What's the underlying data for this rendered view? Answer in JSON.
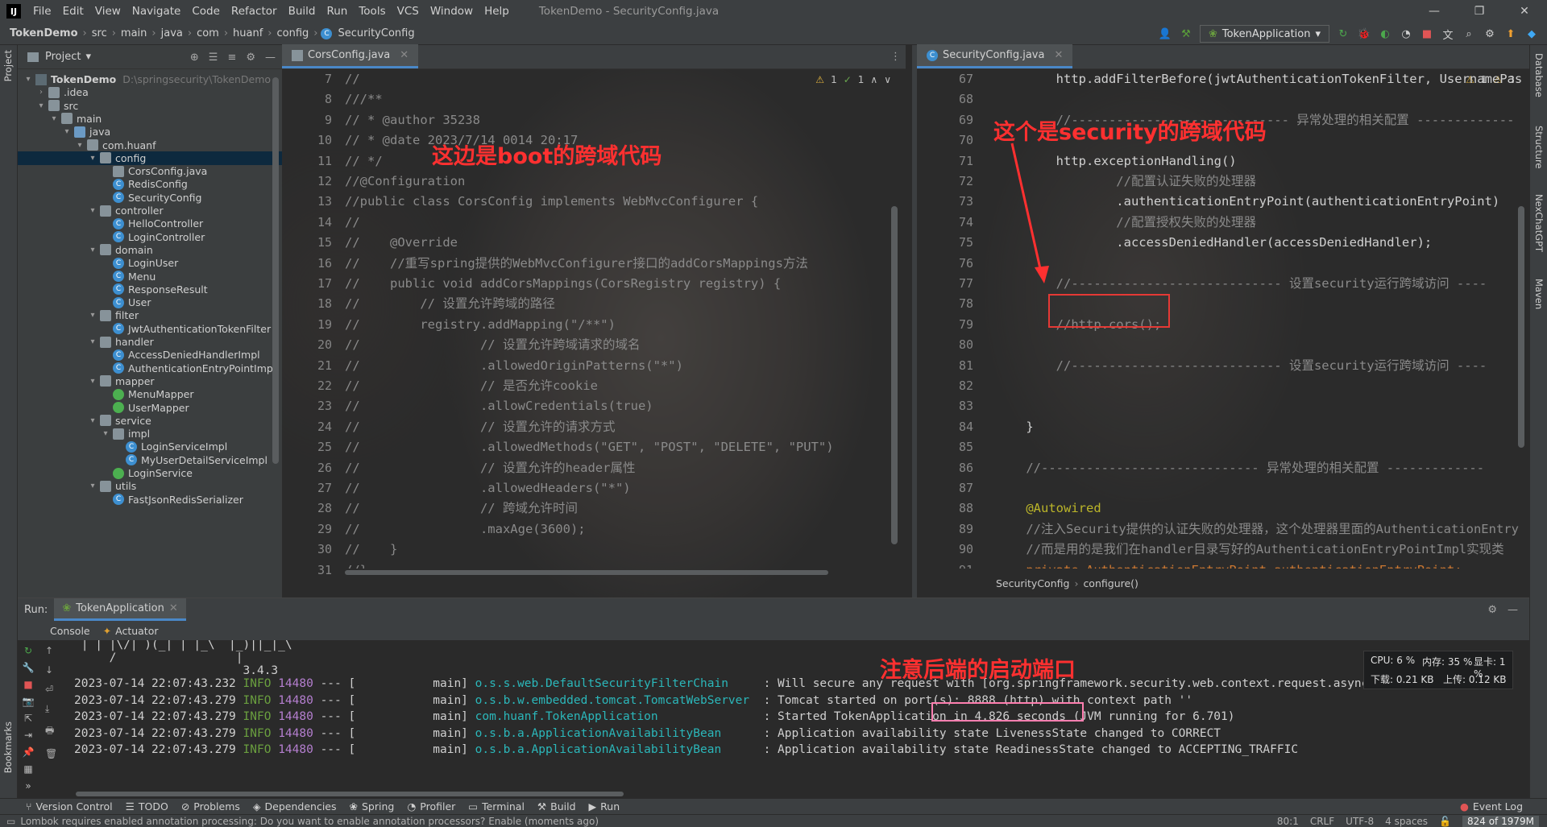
{
  "window": {
    "title": "TokenDemo - SecurityConfig.java",
    "menu": [
      "File",
      "Edit",
      "View",
      "Navigate",
      "Code",
      "Refactor",
      "Build",
      "Run",
      "Tools",
      "VCS",
      "Window",
      "Help"
    ]
  },
  "breadcrumbs": [
    "TokenDemo",
    "src",
    "main",
    "java",
    "com",
    "huanf",
    "config",
    "SecurityConfig"
  ],
  "run_config": "TokenApplication",
  "left_tabs": {
    "project": "Project",
    "bookmarks": "Bookmarks"
  },
  "right_tabs": [
    "Database",
    "Structure",
    "NexChatGPT",
    "Maven"
  ],
  "project_panel": {
    "title": "Project",
    "tree": [
      {
        "label": "TokenDemo",
        "hint": "D:\\springsecurity\\TokenDemo",
        "depth": 0,
        "icon": "proj",
        "arrow": "▾"
      },
      {
        "label": ".idea",
        "depth": 1,
        "icon": "folder",
        "arrow": "›"
      },
      {
        "label": "src",
        "depth": 1,
        "icon": "folder",
        "arrow": "▾"
      },
      {
        "label": "main",
        "depth": 2,
        "icon": "folder",
        "arrow": "▾"
      },
      {
        "label": "java",
        "depth": 3,
        "icon": "fmod",
        "arrow": "▾"
      },
      {
        "label": "com.huanf",
        "depth": 4,
        "icon": "folder",
        "arrow": "▾"
      },
      {
        "label": "config",
        "depth": 5,
        "icon": "folder",
        "arrow": "▾",
        "selected": true
      },
      {
        "label": "CorsConfig.java",
        "depth": 6,
        "icon": "folder",
        "arrow": ""
      },
      {
        "label": "RedisConfig",
        "depth": 6,
        "icon": "class",
        "arrow": ""
      },
      {
        "label": "SecurityConfig",
        "depth": 6,
        "icon": "class",
        "arrow": ""
      },
      {
        "label": "controller",
        "depth": 5,
        "icon": "folder",
        "arrow": "▾"
      },
      {
        "label": "HelloController",
        "depth": 6,
        "icon": "class",
        "arrow": ""
      },
      {
        "label": "LoginController",
        "depth": 6,
        "icon": "class",
        "arrow": ""
      },
      {
        "label": "domain",
        "depth": 5,
        "icon": "folder",
        "arrow": "▾"
      },
      {
        "label": "LoginUser",
        "depth": 6,
        "icon": "class",
        "arrow": ""
      },
      {
        "label": "Menu",
        "depth": 6,
        "icon": "class",
        "arrow": ""
      },
      {
        "label": "ResponseResult",
        "depth": 6,
        "icon": "class",
        "arrow": ""
      },
      {
        "label": "User",
        "depth": 6,
        "icon": "class",
        "arrow": ""
      },
      {
        "label": "filter",
        "depth": 5,
        "icon": "folder",
        "arrow": "▾"
      },
      {
        "label": "JwtAuthenticationTokenFilter",
        "depth": 6,
        "icon": "class",
        "arrow": ""
      },
      {
        "label": "handler",
        "depth": 5,
        "icon": "folder",
        "arrow": "▾"
      },
      {
        "label": "AccessDeniedHandlerImpl",
        "depth": 6,
        "icon": "class",
        "arrow": ""
      },
      {
        "label": "AuthenticationEntryPointImpl",
        "depth": 6,
        "icon": "class",
        "arrow": ""
      },
      {
        "label": "mapper",
        "depth": 5,
        "icon": "folder",
        "arrow": "▾"
      },
      {
        "label": "MenuMapper",
        "depth": 6,
        "icon": "iface",
        "arrow": ""
      },
      {
        "label": "UserMapper",
        "depth": 6,
        "icon": "iface",
        "arrow": ""
      },
      {
        "label": "service",
        "depth": 5,
        "icon": "folder",
        "arrow": "▾"
      },
      {
        "label": "impl",
        "depth": 6,
        "icon": "folder",
        "arrow": "▾"
      },
      {
        "label": "LoginServiceImpl",
        "depth": 7,
        "icon": "class",
        "arrow": ""
      },
      {
        "label": "MyUserDetailServiceImpl",
        "depth": 7,
        "icon": "class",
        "arrow": ""
      },
      {
        "label": "LoginService",
        "depth": 6,
        "icon": "iface",
        "arrow": ""
      },
      {
        "label": "utils",
        "depth": 5,
        "icon": "folder",
        "arrow": "▾"
      },
      {
        "label": "FastJsonRedisSerializer",
        "depth": 6,
        "icon": "class",
        "arrow": ""
      }
    ]
  },
  "editor1": {
    "tab": "CorsConfig.java",
    "inspections": {
      "warnings": "1",
      "checks": "1"
    },
    "lines": [
      {
        "n": "7",
        "t": "//",
        "c": ""
      },
      {
        "n": "8",
        "t": "///**",
        "c": ""
      },
      {
        "n": "9",
        "t": "// * @author 35238",
        "c": ""
      },
      {
        "n": "10",
        "t": "// * @date 2023/7/14 0014 20:17",
        "c": ""
      },
      {
        "n": "11",
        "t": "// */",
        "c": ""
      },
      {
        "n": "12",
        "t": "//@Configuration",
        "c": ""
      },
      {
        "n": "13",
        "t": "//public class CorsConfig implements WebMvcConfigurer {",
        "c": ""
      },
      {
        "n": "14",
        "t": "//",
        "c": ""
      },
      {
        "n": "15",
        "t": "//    @Override",
        "c": ""
      },
      {
        "n": "16",
        "t": "//    //重写spring提供的WebMvcConfigurer接口的addCorsMappings方法",
        "c": ""
      },
      {
        "n": "17",
        "t": "//    public void addCorsMappings(CorsRegistry registry) {",
        "c": ""
      },
      {
        "n": "18",
        "t": "//        // 设置允许跨域的路径",
        "c": ""
      },
      {
        "n": "19",
        "t": "//        registry.addMapping(\"/**\")",
        "c": ""
      },
      {
        "n": "20",
        "t": "//                // 设置允许跨域请求的域名",
        "c": ""
      },
      {
        "n": "21",
        "t": "//                .allowedOriginPatterns(\"*\")",
        "c": ""
      },
      {
        "n": "22",
        "t": "//                // 是否允许cookie",
        "c": ""
      },
      {
        "n": "23",
        "t": "//                .allowCredentials(true)",
        "c": ""
      },
      {
        "n": "24",
        "t": "//                // 设置允许的请求方式",
        "c": ""
      },
      {
        "n": "25",
        "t": "//                .allowedMethods(\"GET\", \"POST\", \"DELETE\", \"PUT\")",
        "c": ""
      },
      {
        "n": "26",
        "t": "//                // 设置允许的header属性",
        "c": ""
      },
      {
        "n": "27",
        "t": "//                .allowedHeaders(\"*\")",
        "c": ""
      },
      {
        "n": "28",
        "t": "//                // 跨域允许时间",
        "c": ""
      },
      {
        "n": "29",
        "t": "//                .maxAge(3600);",
        "c": ""
      },
      {
        "n": "30",
        "t": "//    }",
        "c": ""
      },
      {
        "n": "31",
        "t": "//}",
        "c": ""
      }
    ],
    "annotation": "这边是boot的跨域代码"
  },
  "editor2": {
    "tab": "SecurityConfig.java",
    "inspections": {
      "warnings": "1",
      "checks": "3"
    },
    "lines": [
      {
        "n": "67",
        "t": "        http.addFilterBefore(jwtAuthenticationTokenFilter, UsernamePas",
        "c": "w"
      },
      {
        "n": "68",
        "t": "",
        "c": ""
      },
      {
        "n": "69",
        "t": "        //----------------------------- 异常处理的相关配置 -------------",
        "c": ""
      },
      {
        "n": "70",
        "t": "",
        "c": ""
      },
      {
        "n": "71",
        "t": "        http.exceptionHandling()",
        "c": "w"
      },
      {
        "n": "72",
        "t": "                //配置认证失败的处理器",
        "c": ""
      },
      {
        "n": "73",
        "t": "                .authenticationEntryPoint(authenticationEntryPoint)",
        "c": "w"
      },
      {
        "n": "74",
        "t": "                //配置授权失败的处理器",
        "c": ""
      },
      {
        "n": "75",
        "t": "                .accessDeniedHandler(accessDeniedHandler);",
        "c": "w"
      },
      {
        "n": "76",
        "t": "",
        "c": ""
      },
      {
        "n": "77",
        "t": "        //---------------------------- 设置security运行跨域访问 ----",
        "c": ""
      },
      {
        "n": "78",
        "t": "",
        "c": ""
      },
      {
        "n": "79",
        "t": "        //http.cors();",
        "c": ""
      },
      {
        "n": "80",
        "t": "",
        "c": ""
      },
      {
        "n": "81",
        "t": "        //---------------------------- 设置security运行跨域访问 ----",
        "c": ""
      },
      {
        "n": "82",
        "t": "",
        "c": ""
      },
      {
        "n": "83",
        "t": "",
        "c": ""
      },
      {
        "n": "84",
        "t": "    }",
        "c": "w"
      },
      {
        "n": "85",
        "t": "",
        "c": ""
      },
      {
        "n": "86",
        "t": "    //----------------------------- 异常处理的相关配置 -------------",
        "c": ""
      },
      {
        "n": "87",
        "t": "",
        "c": ""
      },
      {
        "n": "88",
        "t": "    @Autowired",
        "c": "a"
      },
      {
        "n": "89",
        "t": "    //注入Security提供的认证失败的处理器，这个处理器里面的AuthenticationEntry",
        "c": ""
      },
      {
        "n": "90",
        "t": "    //而是用的是我们在handler目录写好的AuthenticationEntryPointImpl实现类",
        "c": ""
      },
      {
        "n": "91",
        "t": "    private AuthenticationEntryPoint authenticationEntryPoint;",
        "c": "k"
      },
      {
        "n": "92",
        "t": "",
        "c": ""
      }
    ],
    "annotation": "这个是security的跨域代码",
    "breadcrumb": [
      "SecurityConfig",
      "configure()"
    ]
  },
  "run_panel": {
    "label": "Run:",
    "tab": "TokenApplication",
    "subtabs": [
      "Console",
      "Actuator"
    ],
    "banner": [
      " | | |\\/| )(_| | |_\\  |_)||_|_\\",
      "     /                 |",
      "                        3.4.3"
    ],
    "logs": [
      {
        "ts": "2023-07-14 22:07:43.232",
        "lvl": "INFO",
        "pid": "14480",
        "sep": "--- [",
        "th": "           main]",
        "lg": "o.s.s.web.DefaultSecurityFilterChain    ",
        "msg": ": Will secure any request with [org.springframework.security.web.context.request.async.WebAsyncManagerIn"
      },
      {
        "ts": "2023-07-14 22:07:43.279",
        "lvl": "INFO",
        "pid": "14480",
        "sep": "--- [",
        "th": "           main]",
        "lg": "o.s.b.w.embedded.tomcat.TomcatWebServer ",
        "msg": ": Tomcat started on port(s): 8888 (http) with context path ''"
      },
      {
        "ts": "2023-07-14 22:07:43.279",
        "lvl": "INFO",
        "pid": "14480",
        "sep": "--- [",
        "th": "           main]",
        "lg": "com.huanf.TokenApplication              ",
        "msg": ": Started TokenApplication in 4.826 seconds (JVM running for 6.701)"
      },
      {
        "ts": "2023-07-14 22:07:43.279",
        "lvl": "INFO",
        "pid": "14480",
        "sep": "--- [",
        "th": "           main]",
        "lg": "o.s.b.a.ApplicationAvailabilityBean     ",
        "msg": ": Application availability state LivenessState changed to CORRECT"
      },
      {
        "ts": "2023-07-14 22:07:43.279",
        "lvl": "INFO",
        "pid": "14480",
        "sep": "--- [",
        "th": "           main]",
        "lg": "o.s.b.a.ApplicationAvailabilityBean     ",
        "msg": ": Application availability state ReadinessState changed to ACCEPTING_TRAFFIC"
      }
    ],
    "annotation": "注意后端的启动端口"
  },
  "sysmon": {
    "cpu": "CPU: 6 %",
    "mem": "内存: 35 %",
    "gpu": "显卡: 1 %",
    "down": "下载: 0.21 KB",
    "up": "上传: 0.12 KB"
  },
  "bottom_tabs": [
    "Version Control",
    "TODO",
    "Problems",
    "Dependencies",
    "Spring",
    "Profiler",
    "Terminal",
    "Build",
    "Run"
  ],
  "event_log": "Event Log",
  "status": {
    "message": "Lombok requires enabled annotation processing: Do you want to enable annotation processors? Enable (moments ago)",
    "pos": "80:1",
    "eol": "CRLF",
    "enc": "UTF-8",
    "indent": "4 spaces",
    "memory": "824 of 1979M"
  },
  "colors": {
    "accent": "#4a88c7",
    "annotation_red": "#ff3030"
  }
}
